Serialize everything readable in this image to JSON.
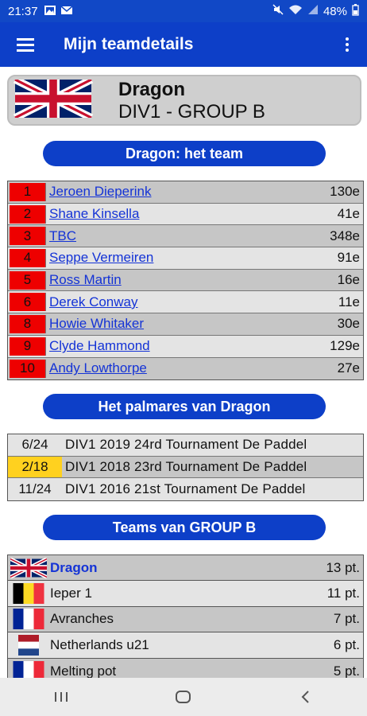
{
  "status_bar": {
    "time": "21:37",
    "battery": "48%",
    "icons": [
      "image-icon",
      "mail-icon",
      "mute-icon",
      "wifi-icon",
      "signal-icon",
      "battery-icon"
    ]
  },
  "app_bar": {
    "title": "Mijn teamdetails",
    "menu_icon": "hamburger-icon",
    "more_icon": "more-vertical-icon"
  },
  "team_header": {
    "name": "Dragon",
    "division": "DIV1 - GROUP B",
    "flag": "united-kingdom-flag"
  },
  "sections": {
    "team_title": "Dragon: het team",
    "palmares_title": "Het palmares van Dragon",
    "group_title": "Teams van GROUP B"
  },
  "players": [
    {
      "num": "1",
      "name": "Jeroen Dieperink",
      "rank": "130e"
    },
    {
      "num": "2",
      "name": "Shane Kinsella",
      "rank": "41e"
    },
    {
      "num": "3",
      "name": "TBC",
      "rank": "348e"
    },
    {
      "num": "4",
      "name": "Seppe Vermeiren",
      "rank": "91e"
    },
    {
      "num": "5",
      "name": "Ross Martin",
      "rank": "16e"
    },
    {
      "num": "6",
      "name": "Derek Conway",
      "rank": "11e"
    },
    {
      "num": "8",
      "name": "Howie Whitaker",
      "rank": "30e"
    },
    {
      "num": "9",
      "name": "Clyde Hammond",
      "rank": "129e"
    },
    {
      "num": "10",
      "name": "Andy Lowthorpe",
      "rank": "27e"
    }
  ],
  "palmares": [
    {
      "pos": "6/24",
      "text": "DIV1 2019 24rd Tournament De Paddel",
      "highlight": false
    },
    {
      "pos": "2/18",
      "text": "DIV1 2018 23rd Tournament De Paddel",
      "highlight": true
    },
    {
      "pos": "11/24",
      "text": "DIV1 2016 21st Tournament De Paddel",
      "highlight": false
    }
  ],
  "group_teams": [
    {
      "flag": "united-kingdom-flag",
      "name": "Dragon",
      "points": "13 pt.",
      "self": true
    },
    {
      "flag": "belgium-flag",
      "name": "Ieper 1",
      "points": "11 pt.",
      "self": false
    },
    {
      "flag": "france-flag",
      "name": "Avranches",
      "points": "7 pt.",
      "self": false
    },
    {
      "flag": "netherlands-flag",
      "name": "Netherlands u21",
      "points": "6 pt.",
      "self": false
    },
    {
      "flag": "france-flag",
      "name": "Melting pot",
      "points": "5 pt.",
      "self": false
    }
  ],
  "nav_bar": [
    "recents-icon",
    "home-icon",
    "back-icon"
  ],
  "colors": {
    "primary": "#0d3fc8",
    "rank_red": "#ee0000",
    "gold": "#ffd11f",
    "link_blue": "#1433d6"
  }
}
